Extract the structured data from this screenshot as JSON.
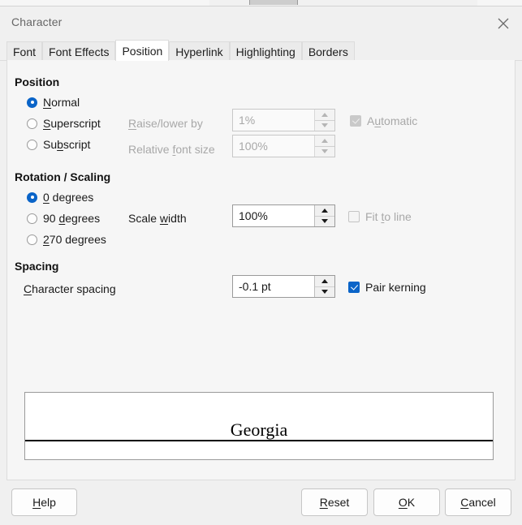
{
  "window": {
    "title": "Character",
    "close_icon": "close-icon"
  },
  "tabs": [
    {
      "label": "Font",
      "active": false
    },
    {
      "label": "Font Effects",
      "active": false
    },
    {
      "label": "Position",
      "active": true
    },
    {
      "label": "Hyperlink",
      "active": false
    },
    {
      "label": "Highlighting",
      "active": false
    },
    {
      "label": "Borders",
      "active": false
    }
  ],
  "position_group": {
    "title": "Position",
    "options": [
      {
        "label": "Normal",
        "selected": true
      },
      {
        "label": "Superscript",
        "selected": false
      },
      {
        "label": "Subscript",
        "selected": false
      }
    ],
    "raise_lower_label": "Raise/lower by",
    "raise_lower_value": "1%",
    "relative_font_size_label": "Relative font size",
    "relative_font_size_value": "100%",
    "automatic_label": "Automatic",
    "automatic_checked": true,
    "automatic_enabled": false
  },
  "rotation_group": {
    "title": "Rotation / Scaling",
    "options": [
      {
        "label": "0 degrees",
        "selected": true
      },
      {
        "label": "90 degrees",
        "selected": false
      },
      {
        "label": "270 degrees",
        "selected": false
      }
    ],
    "scale_width_label": "Scale width",
    "scale_width_value": "100%",
    "fit_to_line_label": "Fit to line",
    "fit_to_line_checked": false,
    "fit_to_line_enabled": false
  },
  "spacing_group": {
    "title": "Spacing",
    "character_spacing_label": "Character spacing",
    "character_spacing_value": "-0.1 pt",
    "pair_kerning_label": "Pair kerning",
    "pair_kerning_checked": true
  },
  "preview": {
    "text": "Georgia"
  },
  "buttons": {
    "help": "Help",
    "reset": "Reset",
    "ok": "OK",
    "cancel": "Cancel"
  },
  "colors": {
    "accent": "#0a64c8",
    "dialog_bg": "#f0f0f0",
    "pane_bg": "#f6f6f6",
    "disabled_text": "#a8a8a8"
  }
}
